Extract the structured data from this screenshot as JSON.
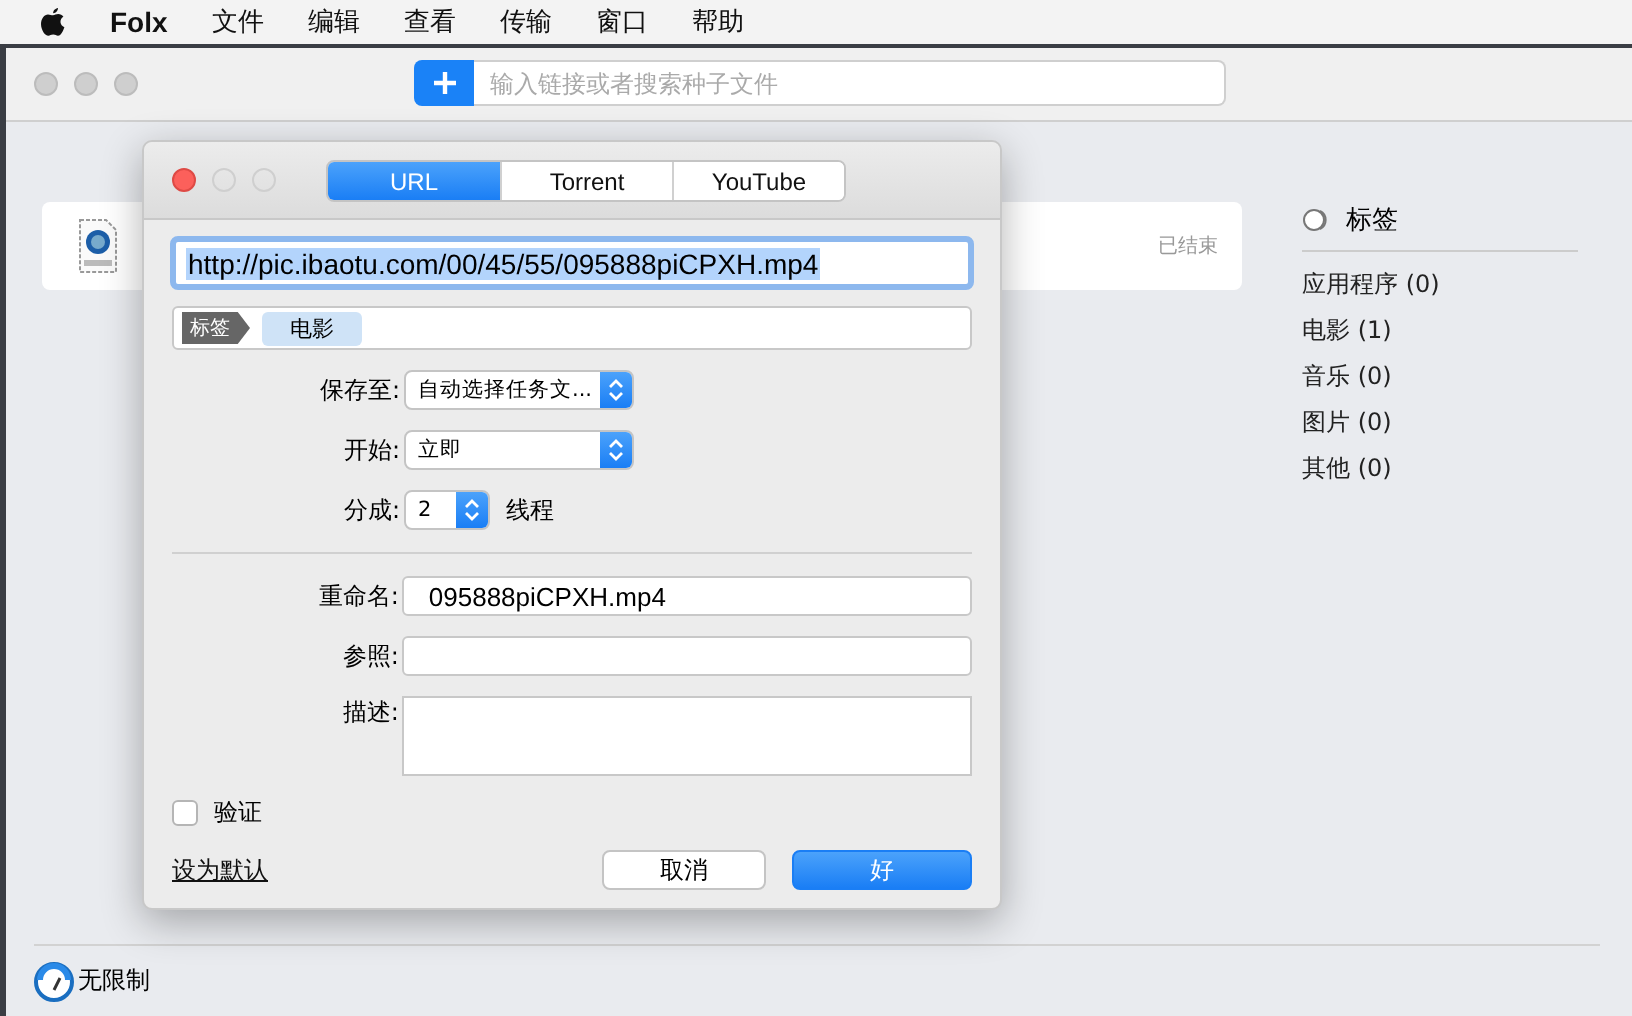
{
  "menubar": {
    "app_name": "Folx",
    "items": [
      "文件",
      "编辑",
      "查看",
      "传输",
      "窗口",
      "帮助"
    ]
  },
  "toolbar": {
    "search": {
      "placeholder": "输入链接或者搜索种子文件"
    }
  },
  "downloads": [
    {
      "status": "已结束"
    }
  ],
  "sidebar": {
    "heading": "标签",
    "items": [
      "应用程序 (0)",
      "电影 (1)",
      "音乐 (0)",
      "图片 (0)",
      "其他 (0)"
    ]
  },
  "status_bar": {
    "speed": "无限制"
  },
  "dialog": {
    "tabs": [
      {
        "label": "URL",
        "selected": true
      },
      {
        "label": "Torrent",
        "selected": false
      },
      {
        "label": "YouTube",
        "selected": false
      }
    ],
    "url": "http://pic.ibaotu.com/00/45/55/095888piCPXH.mp4",
    "tags": {
      "label": "标签",
      "items": [
        "电影"
      ]
    },
    "save_to": {
      "label": "保存至:",
      "value": "自动选择任务文..."
    },
    "start": {
      "label": "开始:",
      "value": "立即"
    },
    "threads": {
      "label": "分成:",
      "value": "2",
      "unit": "线程"
    },
    "rename": {
      "label": "重命名:",
      "value": "095888piCPXH.mp4"
    },
    "reference": {
      "label": "参照:"
    },
    "description": {
      "label": "描述:"
    },
    "verify": {
      "label": "验证",
      "checked": false
    },
    "set_default": "设为默认",
    "buttons": {
      "cancel": "取消",
      "ok": "好"
    }
  }
}
